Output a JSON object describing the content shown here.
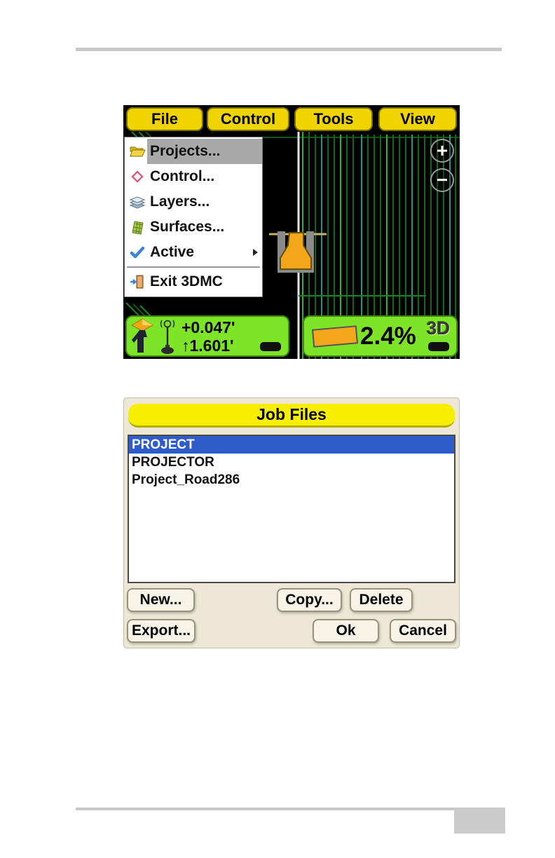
{
  "theme": {
    "accent_yellow": "#f0d400",
    "title_yellow": "#f8ee00",
    "accent_green": "#7de428",
    "selection_blue": "#2e5cc8",
    "dialog_bg": "#ece8d5",
    "button_face": "#f7f3e6",
    "menu_highlight": "#a9a9a9",
    "machine_orange": "#f2a71b"
  },
  "mc": {
    "menu_bar": {
      "items": [
        {
          "label": "File"
        },
        {
          "label": "Control"
        },
        {
          "label": "Tools"
        },
        {
          "label": "View"
        }
      ]
    },
    "file_menu": {
      "items": [
        {
          "label": "Projects...",
          "icon": "folder-open-icon",
          "selected": true
        },
        {
          "label": "Control...",
          "icon": "control-point-icon",
          "selected": false
        },
        {
          "label": "Layers...",
          "icon": "layers-icon",
          "selected": false
        },
        {
          "label": "Surfaces...",
          "icon": "surface-icon",
          "selected": false
        },
        {
          "label": "Active",
          "icon": "checkmark-icon",
          "has_submenu": true,
          "selected": false
        },
        {
          "label": "Exit 3DMC",
          "icon": "exit-door-icon",
          "selected": false
        }
      ]
    },
    "zoom_controls": {
      "zoom_in": "+",
      "zoom_out": "−"
    },
    "status_left": {
      "cut_fill": "+0.047'",
      "antenna_arrow": "↑",
      "antenna_height": "1.601'"
    },
    "status_right": {
      "cross_slope": "2.4%",
      "mode_badge": "3D"
    }
  },
  "job_files": {
    "title": "Job Files",
    "files": [
      {
        "name": "PROJECT",
        "selected": true
      },
      {
        "name": "PROJECTOR",
        "selected": false
      },
      {
        "name": "Project_Road286",
        "selected": false
      }
    ],
    "buttons": {
      "new": "New...",
      "copy": "Copy...",
      "delete": "Delete",
      "export": "Export...",
      "ok": "Ok",
      "cancel": "Cancel"
    }
  }
}
